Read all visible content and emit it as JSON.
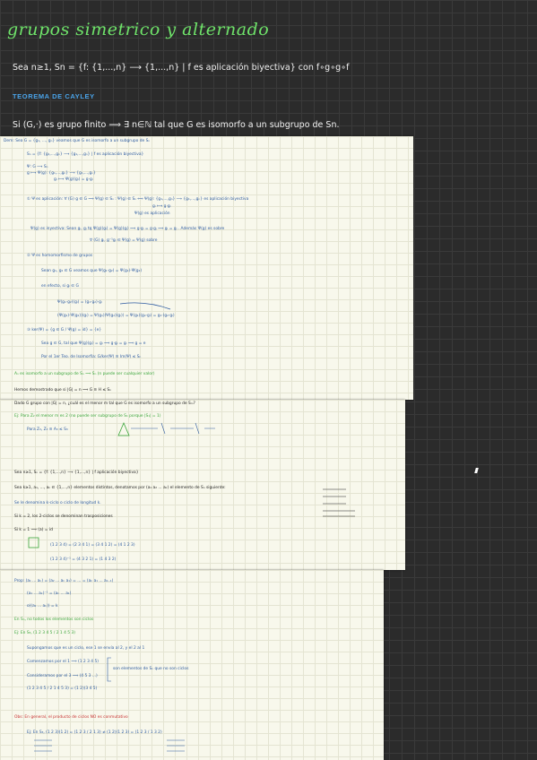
{
  "header": {
    "title": "grupos simetrico y alternado",
    "definition": "Sea n≥1, Sn = {f: {1,...,n} ⟶ {1,...,n} | f es aplicación biyectiva} con f∘g∘g∘f",
    "theorem_heading": "TEOREMA DE CAYLEY",
    "statement": "Si (G,·) es grupo finito ⟹ ∃ n∈ℕ tal que G es isomorfo a un subgrupo de Sn."
  },
  "page1": [
    {
      "text": "Dem: Sea G = {g₁, ..., gₙ} veamos que G es isomorfo a un subgrupo de Sₙ",
      "tone": "dark"
    },
    {
      "text": "Sₙ = {f: {g₁,...,gₙ} ⟶ {g₁,...,gₙ} | f es aplicación biyectiva}",
      "tone": "blue"
    },
    {
      "text": "Ψ: G ⟶ Sₙ",
      "tone": "blue"
    },
    {
      "text": "g ⟼ Ψ(g): {g₁,...,gₙ} ⟶ {g₁,...,gₙ}",
      "tone": "blue"
    },
    {
      "text": "gᵢ ⟼ Ψ(g)(gᵢ) = g·gᵢ",
      "tone": "blue"
    },
    {
      "text": "① Ψ es aplicación: ∀ (G) g ∈ G ⟹ Ψ(g) ∈ Sₙ : Ψ(g) ∈ Sₙ ⟺ Ψ(g): {g₁,...,gₙ} ⟶ {g₁,...,gₙ} es aplicación biyectiva",
      "tone": "blue"
    },
    {
      "text": "gᵢ ⟼ g·gᵢ",
      "tone": "blue"
    },
    {
      "text": "Ψ(g) es aplicación",
      "tone": "blue"
    },
    {
      "text": "Ψ(g) es inyectiva: Sean gᵢ, gⱼ tq Ψ(g)(gᵢ) = Ψ(g)(gⱼ) ⟹ g·gᵢ = g·gⱼ ⟹ gᵢ = gⱼ . Además Ψ(g) es sobre",
      "tone": "blue"
    },
    {
      "text": "∀ (G) gᵢ, g⁻¹gᵢ ∈ Ψ(g) = Ψ(g) sobre",
      "tone": "blue"
    },
    {
      "text": "② Ψ es homomorfismo de grupos",
      "tone": "blue"
    },
    {
      "text": "Sean g₁, g₂ ∈ G veamos que Ψ(g₁·g₂) = Ψ(g₁)·Ψ(g₂)",
      "tone": "blue"
    },
    {
      "text": "en efecto, si gᵢ ∈ G",
      "tone": "blue"
    },
    {
      "text": "Ψ(g₁·g₂)(gᵢ) = (g₁·g₂)·gᵢ",
      "tone": "blue"
    },
    {
      "text": "(Ψ(g₁)·Ψ(g₂))(gᵢ) = Ψ(g₁)(Ψ(g₂)(gᵢ)) = Ψ(g₁)(g₂·gᵢ) = g₁·(g₂·gᵢ)",
      "tone": "blue"
    },
    {
      "text": "③ ker(Ψ) = {g ∈ G / Ψ(g) = id} = {e}",
      "tone": "blue"
    },
    {
      "text": "Sea g ∈ G, tal que Ψ(g)(gᵢ) = gᵢ ⟹ g·gᵢ = gᵢ ⟹ g = e",
      "tone": "blue"
    },
    {
      "text": "Por el 1er Teo. de Isomorfía: G/ker(Ψ) ≅ Im(Ψ) ≤ Sₙ",
      "tone": "blue"
    },
    {
      "text": "Aₙ es isomorfo a un subgrupo de Sₙ ⟹ Sₙ (n puede ser cualquier valor)",
      "tone": "green"
    },
    {
      "text": "Hemos demostrado que si |G| = n ⟹ G ≅ H ≤ Sₙ",
      "tone": "dark"
    }
  ],
  "page2": [
    {
      "text": "Dado G grupo con |G| = n, ¿cuál es el menor m tal que G es isomorfo a un subgrupo de Sₘ?",
      "tone": "dark"
    },
    {
      "text": "Ej: Para Z₂ el menor m es 2 (no puede ser subgrupo de S₁ porque |S₁| = 1)",
      "tone": "green"
    },
    {
      "text": "Para Z₃, Z₃ ≅ A₃ ≤ S₃",
      "tone": "blue"
    },
    {
      "text": "Sea n≥1, Sₙ = {f: {1,...,n} ⟶ {1,...,n} | f aplicación biyectiva}",
      "tone": "dark"
    },
    {
      "text": "Sea k≥1, a₁, ..., aₖ ∈ {1,...,n} elementos distintos, denotamos por (a₁ a₂ ... aₖ) el elemento de Sₙ siguiente:",
      "tone": "dark"
    },
    {
      "text": "Se le denomina k-ciclo o ciclo de longitud k.",
      "tone": "blue"
    },
    {
      "text": "Si k = 2, los 2-ciclos se denominan trasposiciones",
      "tone": "dark"
    },
    {
      "text": "Si k = 1 ⟹ (a) = id",
      "tone": "dark"
    },
    {
      "text": "(1 2 3 4) = (2 3 4 1) = (3 4 1 2) = (4 1 2 3)",
      "tone": "blue"
    },
    {
      "text": "(1 2 3 4)⁻¹ = (4 3 2 1) = (1 4 3 2)",
      "tone": "blue"
    }
  ],
  "page3": [
    {
      "text": "Prop: (a₁ ... aₖ) = (a₂ ... aₖ a₁) = ... = (aₖ a₁ ... aₖ₋₁)",
      "tone": "blue"
    },
    {
      "text": "(a₁ ... aₖ)⁻¹ = (aₖ ... a₁)",
      "tone": "blue"
    },
    {
      "text": "o((a₁ ... aₖ)) = k",
      "tone": "blue"
    },
    {
      "text": "En Sₙ, no todos los elementos son ciclos",
      "tone": "green"
    },
    {
      "text": "Ej: En S₅, (1 2 3 4 5 / 2 1 4 5 3)",
      "tone": "green"
    },
    {
      "text": "Supongamos que es un ciclo, ese 1 se envía al 2, y el 2 al 1",
      "tone": "blue"
    },
    {
      "text": "Comenzamos por el 1 ⟹ (1 2 3 4 5)",
      "tone": "blue"
    },
    {
      "text": "Consideramos por el 3 ⟹ (4 5 3 ...)",
      "tone": "blue"
    },
    {
      "text": "(1 2 3 4 5 / 2 1 4 5 3) = (1 2)(3 4 5)",
      "tone": "blue"
    },
    {
      "text": "son elementos de Sₙ que no son ciclos",
      "tone": "blue"
    },
    {
      "text": "Obs: En general, el producto de ciclos NO es conmutativo",
      "tone": "red"
    },
    {
      "text": "Ej: En S₃, (1 2 3)(1 2) = (1 2 3 / 2 1 3) ≠ (1 2)(1 2 3) = (1 2 3 / 1 3 2)",
      "tone": "blue"
    }
  ]
}
